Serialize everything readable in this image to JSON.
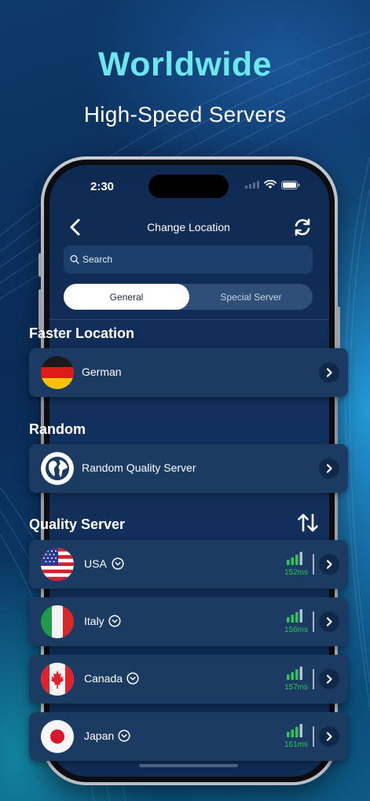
{
  "hero": {
    "title": "Worldwide",
    "subtitle": "High-Speed Servers"
  },
  "status_bar": {
    "time": "2:30"
  },
  "nav": {
    "title": "Change Location",
    "back_icon": "chevron-left-icon",
    "refresh_icon": "refresh-icon"
  },
  "search": {
    "placeholder": "Search"
  },
  "tabs": [
    {
      "label": "General",
      "active": true
    },
    {
      "label": "Special Server",
      "active": false
    }
  ],
  "sections": {
    "faster": "Faster Location",
    "random": "Random",
    "quality": "Quality Server"
  },
  "faster_location": {
    "label": "German",
    "flag": "germany-flag"
  },
  "random_server": {
    "label": "Random Quality Server",
    "icon": "globe-icon"
  },
  "servers": [
    {
      "country": "USA",
      "ping": "152ms",
      "flag": "usa-flag"
    },
    {
      "country": "Italy",
      "ping": "156ms",
      "flag": "italy-flag"
    },
    {
      "country": "Canada",
      "ping": "157ms",
      "flag": "canada-flag"
    },
    {
      "country": "Japan",
      "ping": "161ms",
      "flag": "japan-flag"
    }
  ],
  "colors": {
    "accent_title": "#6de7ee",
    "card_bg": "#1c3b63",
    "ping_green": "#2ec55a",
    "screen_bg": "#12305c"
  }
}
